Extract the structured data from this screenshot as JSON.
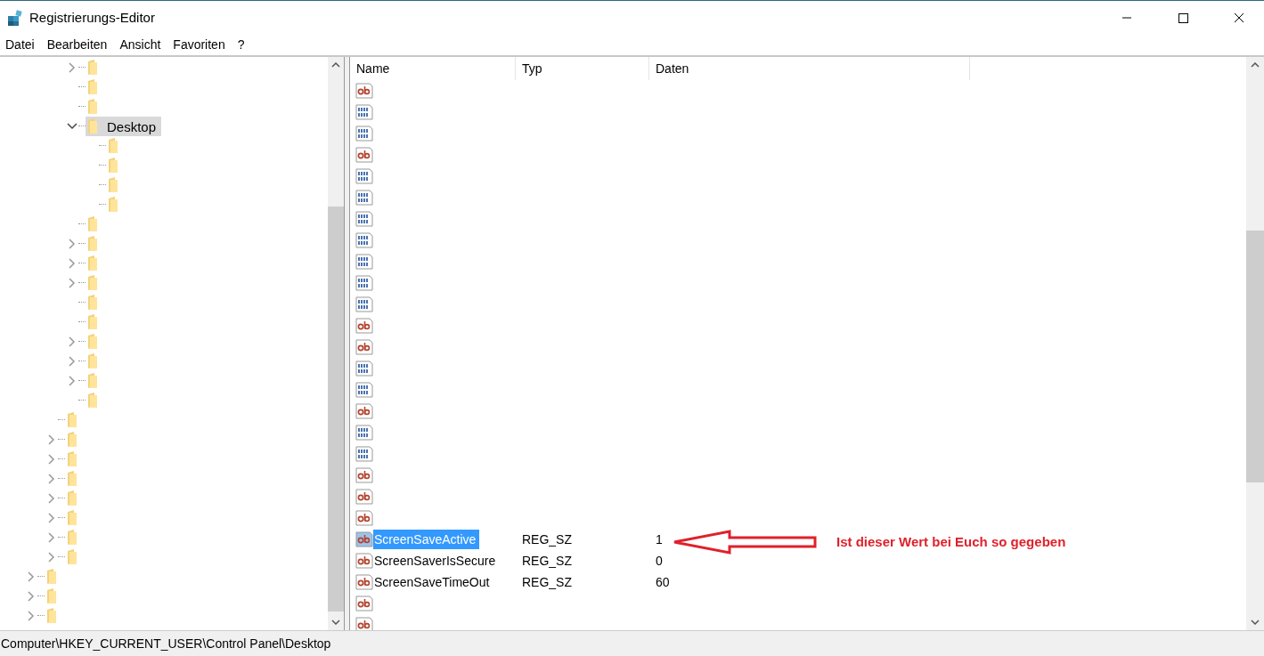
{
  "window": {
    "title": "Registrierungs-Editor"
  },
  "menu": [
    {
      "label": "Datei"
    },
    {
      "label": "Bearbeiten"
    },
    {
      "label": "Ansicht"
    },
    {
      "label": "Favoriten"
    },
    {
      "label": "?"
    }
  ],
  "tree": [
    {
      "children": [
        {
          "children": [
            {
              "expanded": false,
              "selected": false
            },
            {
              "selected": false
            },
            {
              "selected": false
            },
            {
              "expanded": true,
              "selected": true,
              "label": "Desktop",
              "children": [
                {
                  "selected": false
                },
                {
                  "selected": false
                },
                {
                  "selected": false
                },
                {
                  "selected": false
                }
              ]
            },
            {
              "selected": false
            },
            {
              "expanded": false,
              "selected": false
            },
            {
              "expanded": false,
              "selected": false
            },
            {
              "expanded": false,
              "selected": false
            },
            {
              "selected": false
            },
            {
              "selected": false
            },
            {
              "expanded": false,
              "selected": false
            },
            {
              "expanded": false,
              "selected": false
            },
            {
              "expanded": false,
              "selected": false
            },
            {
              "selected": false
            }
          ]
        },
        {
          "selected": false
        },
        {
          "expanded": false,
          "selected": false
        },
        {
          "expanded": false,
          "selected": false
        },
        {
          "expanded": false,
          "selected": false
        },
        {
          "expanded": false,
          "selected": false
        },
        {
          "expanded": false,
          "selected": false
        },
        {
          "expanded": false,
          "selected": false
        },
        {
          "expanded": false,
          "selected": false
        }
      ]
    },
    {
      "expanded": false,
      "selected": false
    },
    {
      "expanded": false,
      "selected": false
    },
    {
      "expanded": false,
      "selected": false
    }
  ],
  "table": {
    "columns": [
      "Name",
      "Typ",
      "Daten"
    ],
    "rows": [
      {
        "kind": "string",
        "selected": false
      },
      {
        "kind": "binary",
        "selected": false
      },
      {
        "kind": "binary",
        "selected": false
      },
      {
        "kind": "string",
        "selected": false
      },
      {
        "kind": "binary",
        "selected": false
      },
      {
        "kind": "binary",
        "selected": false
      },
      {
        "kind": "binary",
        "selected": false
      },
      {
        "kind": "binary",
        "selected": false
      },
      {
        "kind": "binary",
        "selected": false
      },
      {
        "kind": "binary",
        "selected": false
      },
      {
        "kind": "binary",
        "selected": false
      },
      {
        "kind": "string",
        "selected": false
      },
      {
        "kind": "string",
        "selected": false
      },
      {
        "kind": "binary",
        "selected": false
      },
      {
        "kind": "binary",
        "selected": false
      },
      {
        "kind": "string",
        "selected": false
      },
      {
        "kind": "binary",
        "selected": false
      },
      {
        "kind": "binary",
        "selected": false
      },
      {
        "kind": "string",
        "selected": false
      },
      {
        "kind": "string",
        "selected": false
      },
      {
        "kind": "string",
        "selected": false
      },
      {
        "kind": "string",
        "selected": true,
        "name": "ScreenSaveActive",
        "type": "REG_SZ",
        "data": "1"
      },
      {
        "kind": "string",
        "selected": false,
        "name": "ScreenSaverIsSecure",
        "type": "REG_SZ",
        "data": "0"
      },
      {
        "kind": "string",
        "selected": false,
        "name": "ScreenSaveTimeOut",
        "type": "REG_SZ",
        "data": "60"
      },
      {
        "kind": "string",
        "selected": false
      },
      {
        "kind": "string",
        "selected": false
      }
    ]
  },
  "annotation": {
    "text": "Ist dieser Wert bei Euch so gegeben"
  },
  "status_bar": "Computer\\HKEY_CURRENT_USER\\Control Panel\\Desktop"
}
